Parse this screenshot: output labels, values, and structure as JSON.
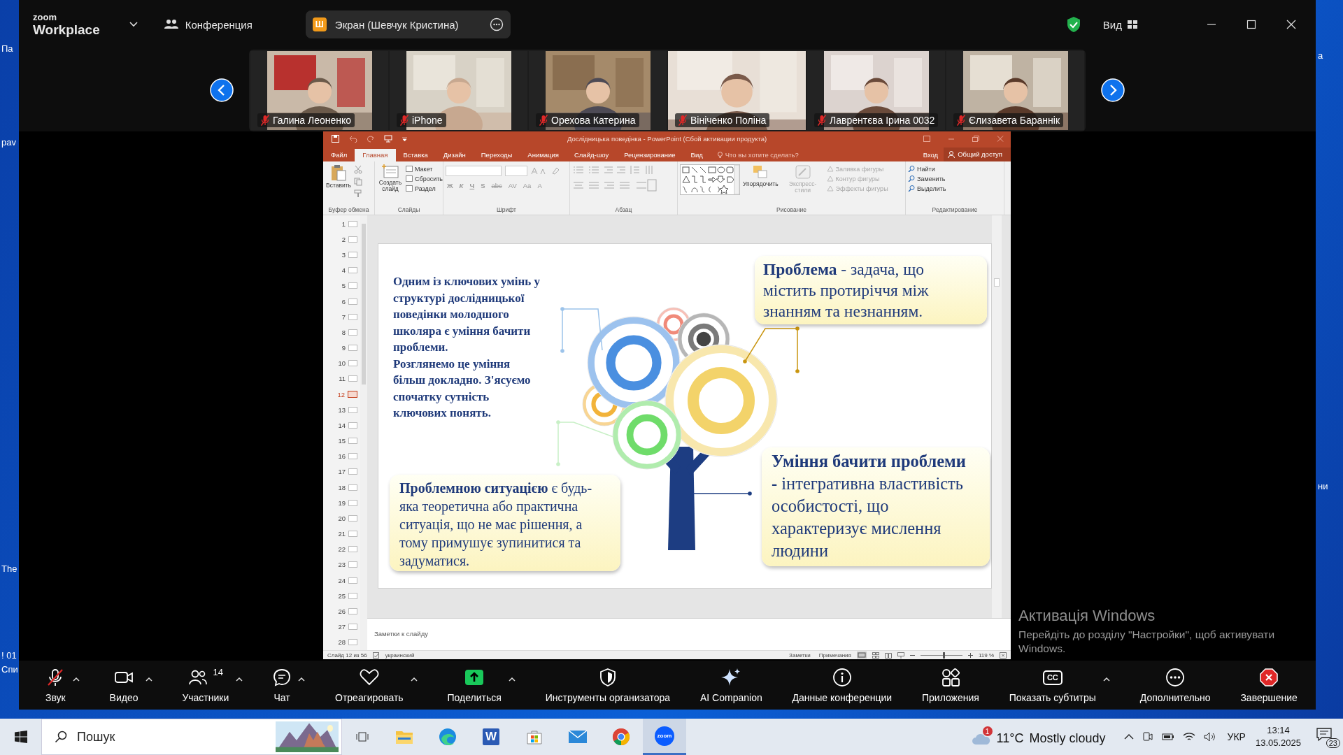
{
  "desktop": {
    "left_labels": [
      "Па",
      "pav",
      "The",
      "! 01",
      "Спи"
    ],
    "right_labels": [
      "а",
      "ни"
    ]
  },
  "zoom": {
    "logo_small": "zoom",
    "logo_large": "Workplace",
    "meeting_label": "Конференция",
    "share_pill": {
      "initial": "Ш",
      "label": "Экран (Шевчук Кристина)"
    },
    "view_label": "Вид",
    "participants": [
      {
        "name": "Галина Леоненко",
        "muted": true
      },
      {
        "name": "iPhone",
        "muted": true
      },
      {
        "name": "Орехова Катерина",
        "muted": true
      },
      {
        "name": "Вініченко Поліна",
        "muted": true
      },
      {
        "name": "Лаврентєва Ірина 0032",
        "muted": true
      },
      {
        "name": "Єлизавета Бараннік",
        "muted": true
      }
    ],
    "toolbar": [
      {
        "kind": "audio",
        "label": "Звук",
        "muted": true,
        "has_menu": true
      },
      {
        "kind": "video",
        "label": "Видео",
        "has_menu": true
      },
      {
        "kind": "participants",
        "label": "Участники",
        "count": "14",
        "has_menu": true
      },
      {
        "kind": "chat",
        "label": "Чат",
        "has_menu": true
      },
      {
        "kind": "react",
        "label": "Отреагировать",
        "has_menu": true
      },
      {
        "kind": "share",
        "label": "Поделиться",
        "has_menu": true
      },
      {
        "kind": "host",
        "label": "Инструменты организатора",
        "has_menu": false
      },
      {
        "kind": "ai",
        "label": "AI Companion",
        "has_menu": false
      },
      {
        "kind": "info",
        "label": "Данные конференции",
        "has_menu": false
      },
      {
        "kind": "apps",
        "label": "Приложения",
        "has_menu": false
      },
      {
        "kind": "captions",
        "label": "Показать субтитры",
        "glyph": "CC",
        "has_menu": true
      },
      {
        "kind": "more",
        "label": "Дополнительно",
        "has_menu": false
      },
      {
        "kind": "end",
        "label": "Завершение",
        "has_menu": false
      }
    ]
  },
  "powerpoint": {
    "title": "Дослідницька поведінка - PowerPoint (Сбой активации продукта)",
    "tabs": [
      {
        "label": "Файл",
        "selected": false
      },
      {
        "label": "Главная",
        "selected": true
      },
      {
        "label": "Вставка",
        "selected": false
      },
      {
        "label": "Дизайн",
        "selected": false
      },
      {
        "label": "Переходы",
        "selected": false
      },
      {
        "label": "Анимация",
        "selected": false
      },
      {
        "label": "Слайд-шоу",
        "selected": false
      },
      {
        "label": "Рецензирование",
        "selected": false
      },
      {
        "label": "Вид",
        "selected": false
      }
    ],
    "tell_me": "Что вы хотите сделать?",
    "sign_in": "Вход",
    "share": "Общий доступ",
    "ribbon": [
      {
        "kind": "clipboard",
        "label": "Буфер обмена",
        "large": [
          {
            "label": "Вставить",
            "disabled": false
          }
        ]
      },
      {
        "kind": "slides",
        "label": "Слайды",
        "large": [
          {
            "label": "Создать слайд",
            "disabled": false
          }
        ],
        "small": [
          {
            "label": "Макет",
            "disabled": false
          },
          {
            "label": "Сбросить",
            "disabled": false
          },
          {
            "label": "Раздел",
            "disabled": false
          }
        ]
      },
      {
        "kind": "font",
        "label": "Шрифт",
        "format_buttons": [
          "Ж",
          "К",
          "Ч",
          "S",
          "abc",
          "AV",
          "Aa",
          "A"
        ]
      },
      {
        "kind": "paragraph",
        "label": "Абзац"
      },
      {
        "kind": "drawing",
        "label": "Рисование",
        "large": [
          {
            "label": "Упорядочить",
            "disabled": false
          },
          {
            "label": "Экспресс-стили",
            "disabled": true
          }
        ],
        "small": [
          {
            "label": "Заливка фигуры",
            "disabled": true
          },
          {
            "label": "Контур фигуры",
            "disabled": true
          },
          {
            "label": "Эффекты фигуры",
            "disabled": true
          }
        ]
      },
      {
        "kind": "editing",
        "label": "Редактирование",
        "small": [
          {
            "label": "Найти",
            "disabled": false
          },
          {
            "label": "Заменить",
            "disabled": false
          },
          {
            "label": "Выделить",
            "disabled": false
          }
        ]
      }
    ],
    "slides": [
      {
        "number": "1",
        "selected": false
      },
      {
        "number": "2",
        "selected": false
      },
      {
        "number": "3",
        "selected": false
      },
      {
        "number": "4",
        "selected": false
      },
      {
        "number": "5",
        "selected": false
      },
      {
        "number": "6",
        "selected": false
      },
      {
        "number": "7",
        "selected": false
      },
      {
        "number": "8",
        "selected": false
      },
      {
        "number": "9",
        "selected": false
      },
      {
        "number": "10",
        "selected": false
      },
      {
        "number": "11",
        "selected": false
      },
      {
        "number": "12",
        "selected": true
      },
      {
        "number": "13",
        "selected": false
      },
      {
        "number": "14",
        "selected": false
      },
      {
        "number": "15",
        "selected": false
      },
      {
        "number": "16",
        "selected": false
      },
      {
        "number": "17",
        "selected": false
      },
      {
        "number": "18",
        "selected": false
      },
      {
        "number": "19",
        "selected": false
      },
      {
        "number": "20",
        "selected": false
      },
      {
        "number": "21",
        "selected": false
      },
      {
        "number": "22",
        "selected": false
      },
      {
        "number": "23",
        "selected": false
      },
      {
        "number": "24",
        "selected": false
      },
      {
        "number": "25",
        "selected": false
      },
      {
        "number": "26",
        "selected": false
      },
      {
        "number": "27",
        "selected": false
      },
      {
        "number": "28",
        "selected": false
      }
    ],
    "slide": {
      "intro": [
        "Одним із ключових умінь у структурі дослідницької поведінки молодшого школяра є уміння бачити проблеми.",
        "Розглянемо це уміння більш докладно. З'ясуємо спочатку сутність ключових понять."
      ],
      "callouts": [
        {
          "kind": "top-right",
          "text": "**Проблема** - задача, що містить протиріччя між знанням та незнанням."
        },
        {
          "kind": "bottom-left",
          "text": "**Проблемною ситуацією** є будь-яка теоретична або практична ситуація, що не має рішення, а тому примушує зупинитися та задуматися."
        },
        {
          "kind": "bottom-right",
          "text": "**Уміння бачити проблеми -** інтегративна властивість особистості, що характеризує мислення людини"
        }
      ]
    },
    "notes_placeholder": "Заметки к слайду",
    "status": {
      "slide_info": "Слайд 12 из 56",
      "language": "украинский",
      "notes_button": "Заметки",
      "comments_button": "Примечания",
      "zoom_slider": {
        "level": 0.53
      },
      "zoom_text": "119 %"
    }
  },
  "activation": {
    "title": "Активація Windows",
    "text": "Перейдіть до розділу \"Настройки\", щоб активувати Windows."
  },
  "taskbar": {
    "search_placeholder": "Пошук",
    "apps": [
      {
        "kind": "explorer",
        "active": false
      },
      {
        "kind": "edge",
        "active": false
      },
      {
        "kind": "word",
        "glyph": "W",
        "active": false
      },
      {
        "kind": "store",
        "active": false
      },
      {
        "kind": "mail",
        "active": false
      },
      {
        "kind": "chrome",
        "active": false
      },
      {
        "kind": "zoom",
        "glyph": "zoom",
        "active": true
      }
    ],
    "weather": {
      "badge": "1",
      "temperature": "11°C",
      "condition": "Mostly cloudy"
    },
    "language": "УКР",
    "time": "13:14",
    "date": "13.05.2025",
    "notifications": "23"
  }
}
